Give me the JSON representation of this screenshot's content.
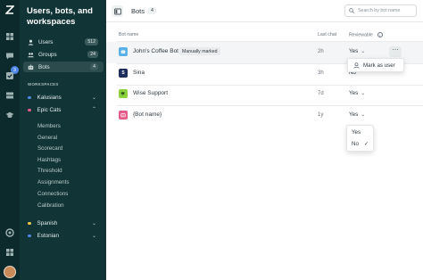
{
  "rail": {
    "icons": [
      "zendesk-logo-icon",
      "dashboard-icon",
      "chat-icon",
      "checkbox-icon",
      "inbox-icon",
      "graduation-cap-icon",
      "help-icon",
      "apps-grid-icon"
    ],
    "badge": "3"
  },
  "sidebar": {
    "title": "Users, bots, and workspaces",
    "items": [
      {
        "label": "Users",
        "count": "512",
        "icon": "user-icon"
      },
      {
        "label": "Groups",
        "count": "24",
        "icon": "groups-icon"
      },
      {
        "label": "Bots",
        "count": "4",
        "icon": "bot-icon"
      }
    ],
    "workspaces_heading": "WORKSPACES",
    "workspaces": [
      {
        "label": "Kalusians",
        "dot_color": "#4f86e6"
      },
      {
        "label": "Epic Cats",
        "dot_color": "#e35b87"
      },
      {
        "label": "Spanish",
        "dot_color": "#f2c94c"
      },
      {
        "label": "Estonian",
        "dot_color": "#4f86e6"
      }
    ],
    "subitems": [
      "Members",
      "General",
      "Scorecard",
      "Hashtags",
      "Threshold",
      "Assignments",
      "Connections",
      "Calibration"
    ]
  },
  "header": {
    "title": "Bots",
    "count": "4",
    "search_placeholder": "Search by bot name"
  },
  "table": {
    "columns": {
      "name": "Bot name",
      "last_chat": "Last chat",
      "reviewable": "Reviewable"
    },
    "rows": [
      {
        "name": "John's Coffee Bot",
        "tag": "Manually marked",
        "last_chat": "2h",
        "reviewable": "Yes",
        "icon_color": "#5ab0e8",
        "icon_letter": ""
      },
      {
        "name": "Sina",
        "tag": "",
        "last_chat": "3h",
        "reviewable": "No",
        "icon_color": "#1d2d5c",
        "icon_letter": "S"
      },
      {
        "name": "Wise Support",
        "tag": "",
        "last_chat": "7d",
        "reviewable": "Yes",
        "icon_color": "#8bd13c",
        "icon_letter": ""
      },
      {
        "name": "{Bot name}",
        "tag": "",
        "last_chat": "1y",
        "reviewable": "Yes",
        "icon_color": "#e35b87",
        "icon_letter": ""
      }
    ]
  },
  "row_menu": {
    "item": "Mark as user"
  },
  "reviewable_dropdown": {
    "options": [
      "Yes",
      "No"
    ],
    "selected": "No"
  },
  "colors": {
    "sidebar_bg": "#113436",
    "rail_bg": "#0c2a2c",
    "accent": "#4f86e6"
  }
}
